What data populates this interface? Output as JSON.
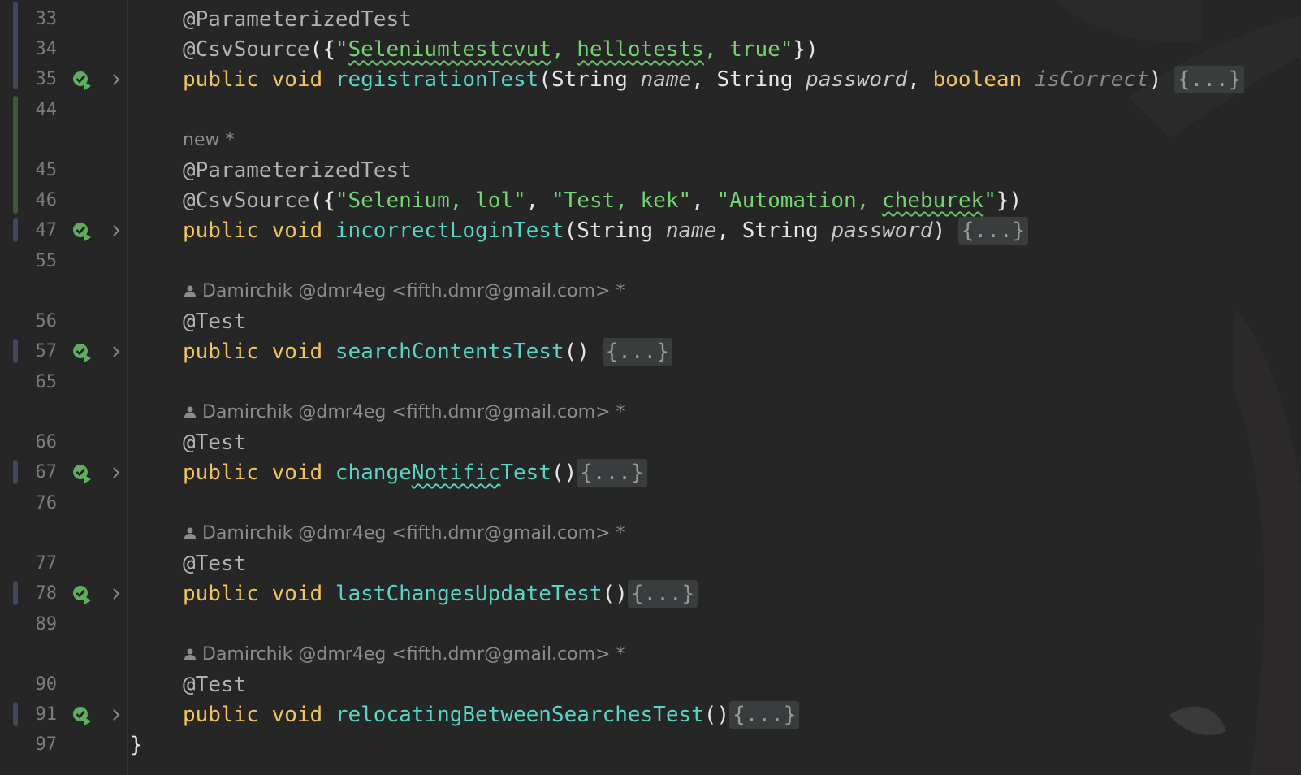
{
  "editor": {
    "lines": {
      "l33": "33",
      "l34": "34",
      "l35": "35",
      "l44": "44",
      "l45": "45",
      "l46": "46",
      "l47": "47",
      "l55": "55",
      "l56": "56",
      "l57": "57",
      "l65": "65",
      "l66": "66",
      "l67": "67",
      "l76": "76",
      "l77": "77",
      "l78": "78",
      "l89": "89",
      "l90": "90",
      "l91": "91",
      "l97": "97"
    },
    "fold_placeholder": "{...}",
    "t": {
      "ann_parameterized": "@ParameterizedTest",
      "ann_csvsource": "@CsvSource",
      "ann_test": "@Test",
      "open_paren_brace": "({",
      "close_brace_paren": "})",
      "kw_public_void": "public void ",
      "kw_boolean": "boolean ",
      "type_string": "String ",
      "comma_space": ", ",
      "close_paren_space": ") ",
      "close_paren": ")",
      "open_paren": "(",
      "empty_parens_space": "() ",
      "empty_parens": "()",
      "quote": "\"",
      "quote_comma_space": "\", ",
      "closing_brace": "}"
    },
    "csv1": {
      "a": "Seleniumtestcvut",
      "b": ", ",
      "c": "hellotests",
      "d": ", true"
    },
    "csv2": {
      "s1": "\"Selenium, lol\"",
      "s2": "\"Test, kek\"",
      "s3a": "\"Automation, ",
      "s3b": "cheburek",
      "s3c": "\""
    },
    "methods": {
      "registration": "registrationTest",
      "incorrectLogin": "incorrectLoginTest",
      "searchContents": "searchContentsTest",
      "changeNotific_a": "change",
      "changeNotific_b": "Notific",
      "changeNotific_c": "Test",
      "lastChanges": "lastChangesUpdateTest",
      "relocating": "relocatingBetweenSearchesTest"
    },
    "params": {
      "name": "name",
      "password": "password",
      "isCorrect": "isCorrect"
    },
    "hints": {
      "new_hint": "new *",
      "author": "Damirchik @dmr4eg <fifth.dmr@gmail.com> *"
    },
    "colors": {
      "background": "#262626",
      "keyword": "#f2c55c",
      "function": "#56d6c4",
      "string": "#72d572",
      "annotation": "#b3b3b3",
      "line_number": "#7c7c7c"
    },
    "icons": {
      "run": "run-test-icon",
      "fold": "chevron-right-icon",
      "author": "person-icon"
    }
  }
}
